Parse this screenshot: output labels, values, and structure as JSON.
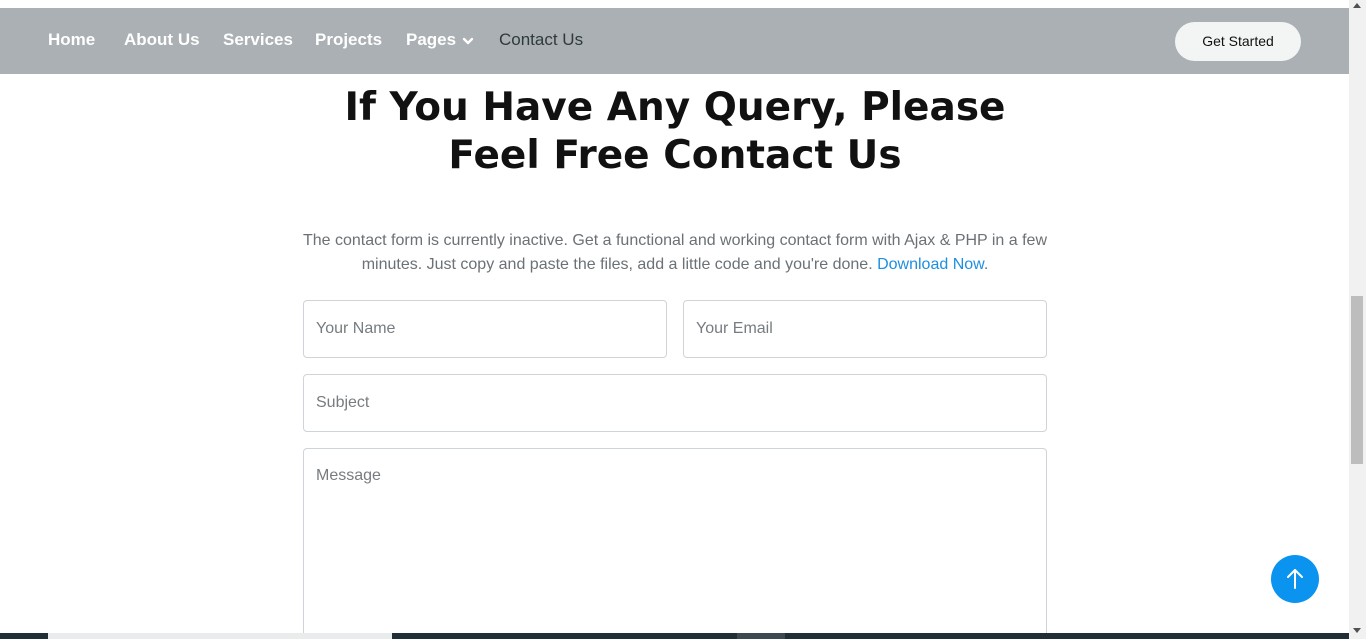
{
  "nav": {
    "items": [
      {
        "label": "Home"
      },
      {
        "label": "About Us"
      },
      {
        "label": "Services"
      },
      {
        "label": "Projects"
      },
      {
        "label": "Pages"
      },
      {
        "label": "Contact Us"
      }
    ],
    "active": "Contact Us",
    "cta_label": "Get Started"
  },
  "contact": {
    "heading_line1": "If You Have Any Query, Please",
    "heading_line2": "Feel Free Contact Us",
    "intro_text": "The contact form is currently inactive. Get a functional and working contact form with Ajax & PHP in a few minutes. Just copy and paste the files, add a little code and you're done.",
    "intro_link": "Download Now",
    "intro_period": ".",
    "form": {
      "name_placeholder": "Your Name",
      "email_placeholder": "Your Email",
      "subject_placeholder": "Subject",
      "message_placeholder": "Message"
    }
  },
  "colors": {
    "navbar_bg": "#aab0b3",
    "accent": "#0b93f0",
    "link": "#1d8fe0"
  },
  "icons": {
    "pages_dropdown": "chevron-down-icon",
    "back_to_top": "arrow-up-icon"
  }
}
